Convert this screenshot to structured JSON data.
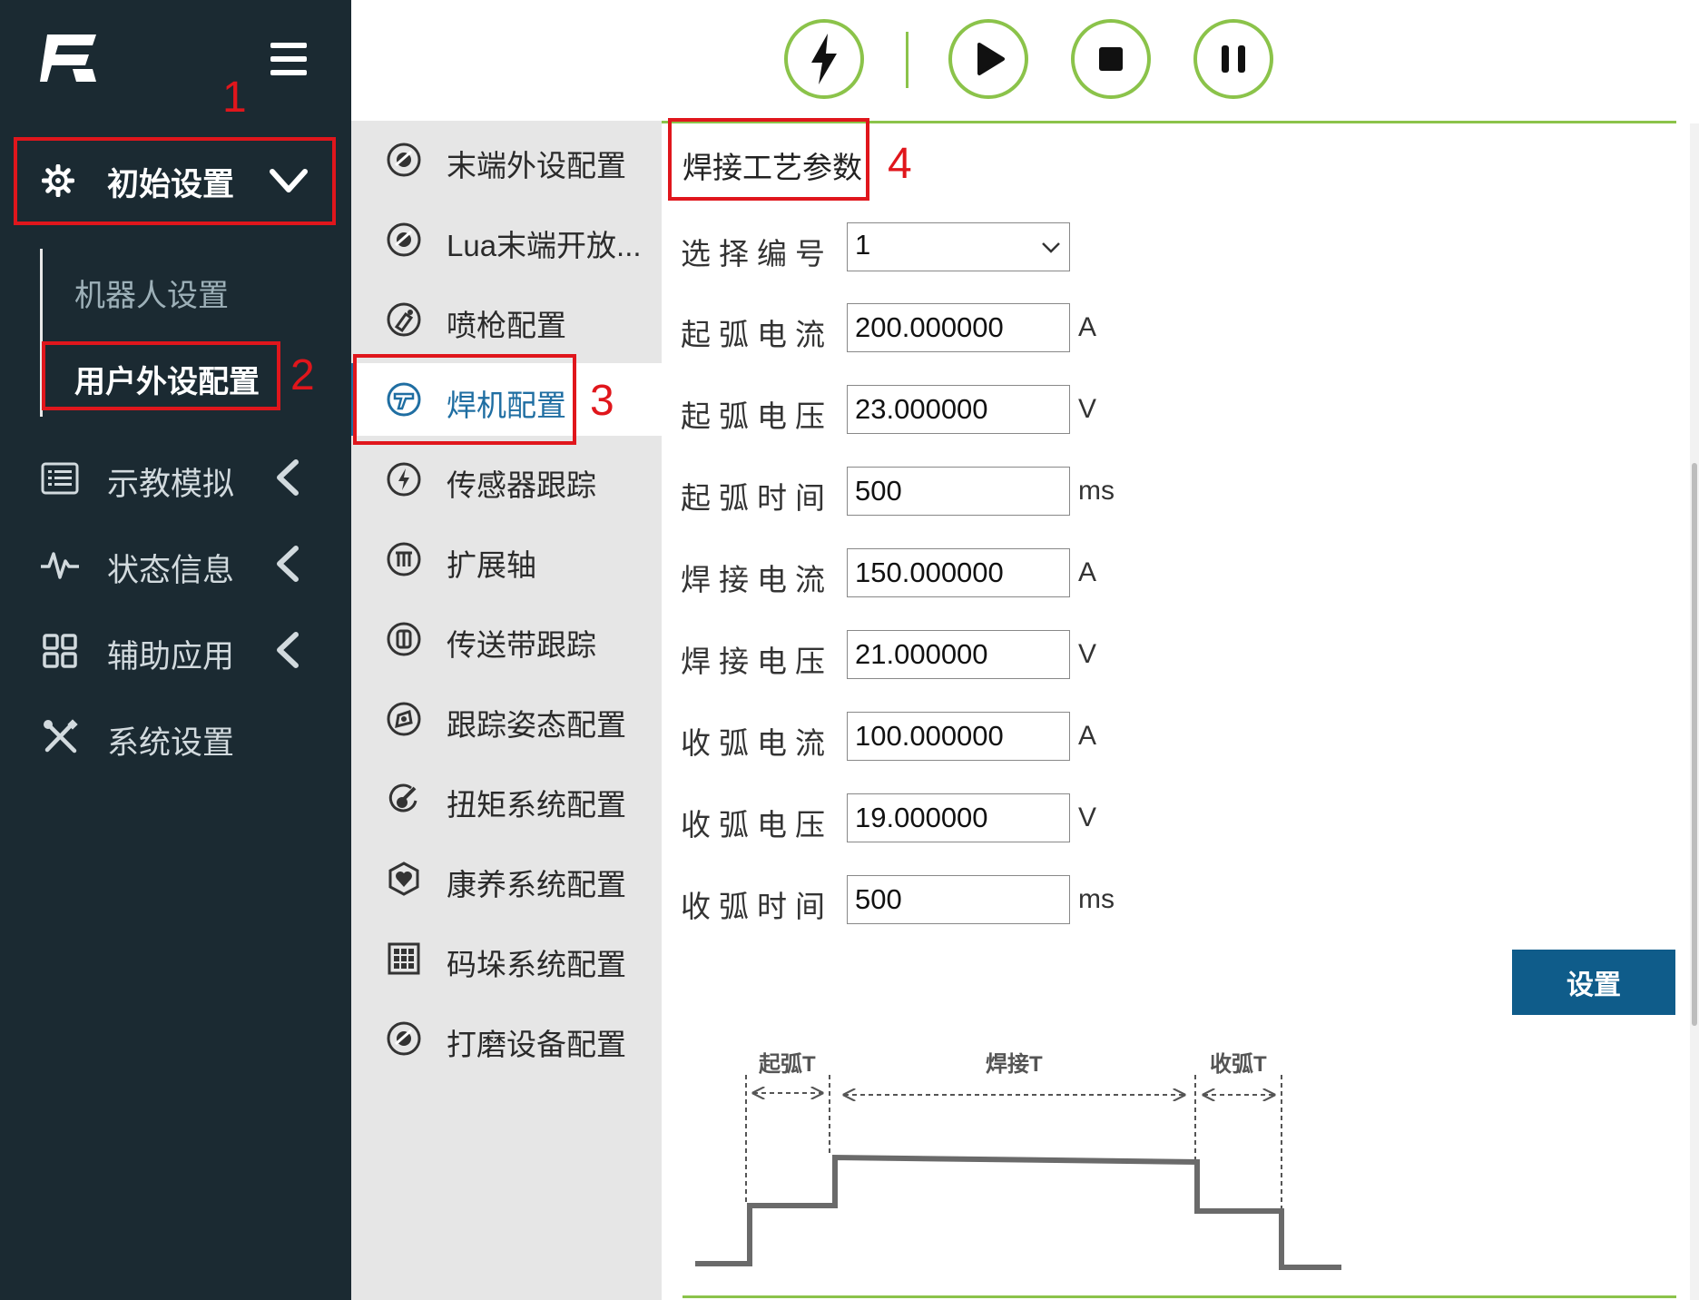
{
  "sidebar": {
    "init_label": "初始设置",
    "sub_items": [
      "机器人设置",
      "用户外设配置"
    ],
    "items": [
      {
        "label": "示教模拟",
        "icon": "list-icon"
      },
      {
        "label": "状态信息",
        "icon": "pulse-icon"
      },
      {
        "label": "辅助应用",
        "icon": "grid-apps-icon"
      },
      {
        "label": "系统设置",
        "icon": "tools-icon"
      }
    ]
  },
  "toolbar": {
    "buttons": [
      "lightning-icon",
      "play-icon",
      "stop-icon",
      "pause-icon"
    ]
  },
  "submenu": {
    "items": [
      {
        "label": "末端外设配置",
        "icon": "end-effector-icon"
      },
      {
        "label": "Lua末端开放...",
        "icon": "end-effector-icon"
      },
      {
        "label": "喷枪配置",
        "icon": "spray-gun-icon"
      },
      {
        "label": "焊机配置",
        "icon": "welder-icon",
        "active": true
      },
      {
        "label": "传感器跟踪",
        "icon": "sensor-icon"
      },
      {
        "label": "扩展轴",
        "icon": "axis-icon"
      },
      {
        "label": "传送带跟踪",
        "icon": "conveyor-icon"
      },
      {
        "label": "跟踪姿态配置",
        "icon": "pose-icon"
      },
      {
        "label": "扭矩系统配置",
        "icon": "torque-icon"
      },
      {
        "label": "康养系统配置",
        "icon": "health-icon"
      },
      {
        "label": "码垛系统配置",
        "icon": "palletizing-icon"
      },
      {
        "label": "打磨设备配置",
        "icon": "grinding-icon"
      }
    ]
  },
  "form": {
    "title": "焊接工艺参数",
    "select_label": "选择编号",
    "select_value": "1",
    "rows": [
      {
        "label": "起弧电流",
        "value": "200.000000",
        "unit": "A"
      },
      {
        "label": "起弧电压",
        "value": "23.000000",
        "unit": "V"
      },
      {
        "label": "起弧时间",
        "value": "500",
        "unit": "ms"
      },
      {
        "label": "焊接电流",
        "value": "150.000000",
        "unit": "A"
      },
      {
        "label": "焊接电压",
        "value": "21.000000",
        "unit": "V"
      },
      {
        "label": "收弧电流",
        "value": "100.000000",
        "unit": "A"
      },
      {
        "label": "收弧电压",
        "value": "19.000000",
        "unit": "V"
      },
      {
        "label": "收弧时间",
        "value": "500",
        "unit": "ms"
      }
    ],
    "set_button": "设置"
  },
  "diagram": {
    "labels": [
      "起弧T",
      "焊接T",
      "收弧T"
    ]
  },
  "annotations": [
    "1",
    "2",
    "3",
    "4"
  ],
  "colors": {
    "sidebar_bg": "#1b2a32",
    "accent_green": "#8bc34a",
    "active_blue": "#1f6ea2",
    "button_blue": "#0f5c8a",
    "annotation_red": "#e0161c"
  }
}
